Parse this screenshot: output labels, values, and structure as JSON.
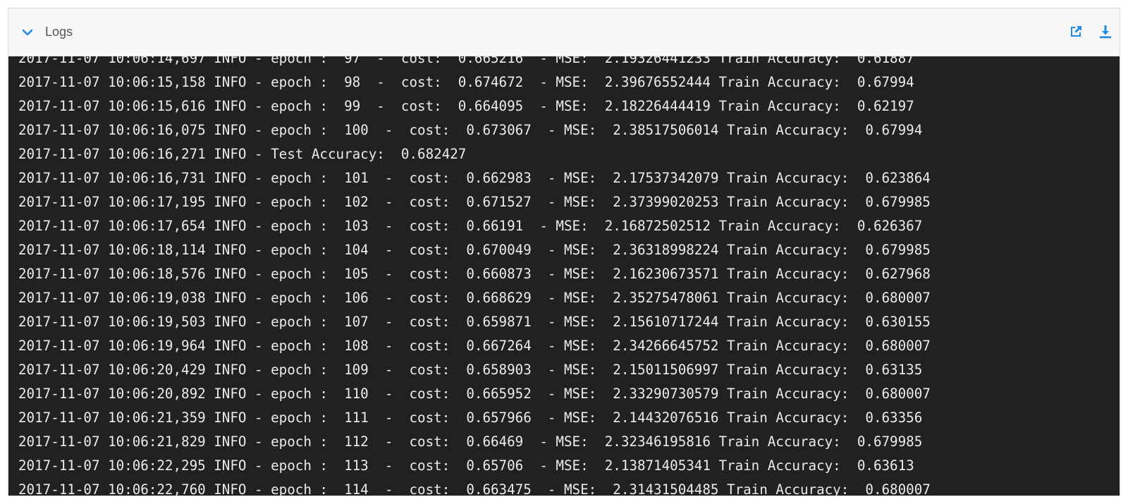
{
  "panel": {
    "title": "Logs",
    "toggle_icon": "chevron-down-icon",
    "actions": [
      {
        "name": "open-external",
        "icon": "external-link-icon"
      },
      {
        "name": "download",
        "icon": "download-icon"
      }
    ],
    "accent_color": "#1e88e5",
    "console_background": "#212121",
    "console_text_color": "#ececec"
  },
  "logs": {
    "lines": [
      "2017-11-07 10:06:14,697 INFO - epoch :  97  -  cost:  0.665216  - MSE:  2.19326441233 Train Accuracy:  0.61887",
      "2017-11-07 10:06:15,158 INFO - epoch :  98  -  cost:  0.674672  - MSE:  2.39676552444 Train Accuracy:  0.67994",
      "2017-11-07 10:06:15,616 INFO - epoch :  99  -  cost:  0.664095  - MSE:  2.18226444419 Train Accuracy:  0.62197",
      "2017-11-07 10:06:16,075 INFO - epoch :  100  -  cost:  0.673067  - MSE:  2.38517506014 Train Accuracy:  0.67994",
      "2017-11-07 10:06:16,271 INFO - Test Accuracy:  0.682427",
      "2017-11-07 10:06:16,731 INFO - epoch :  101  -  cost:  0.662983  - MSE:  2.17537342079 Train Accuracy:  0.623864",
      "2017-11-07 10:06:17,195 INFO - epoch :  102  -  cost:  0.671527  - MSE:  2.37399020253 Train Accuracy:  0.679985",
      "2017-11-07 10:06:17,654 INFO - epoch :  103  -  cost:  0.66191  - MSE:  2.16872502512 Train Accuracy:  0.626367",
      "2017-11-07 10:06:18,114 INFO - epoch :  104  -  cost:  0.670049  - MSE:  2.36318998224 Train Accuracy:  0.679985",
      "2017-11-07 10:06:18,576 INFO - epoch :  105  -  cost:  0.660873  - MSE:  2.16230673571 Train Accuracy:  0.627968",
      "2017-11-07 10:06:19,038 INFO - epoch :  106  -  cost:  0.668629  - MSE:  2.35275478061 Train Accuracy:  0.680007",
      "2017-11-07 10:06:19,503 INFO - epoch :  107  -  cost:  0.659871  - MSE:  2.15610717244 Train Accuracy:  0.630155",
      "2017-11-07 10:06:19,964 INFO - epoch :  108  -  cost:  0.667264  - MSE:  2.34266645752 Train Accuracy:  0.680007",
      "2017-11-07 10:06:20,429 INFO - epoch :  109  -  cost:  0.658903  - MSE:  2.15011506997 Train Accuracy:  0.63135",
      "2017-11-07 10:06:20,892 INFO - epoch :  110  -  cost:  0.665952  - MSE:  2.33290730579 Train Accuracy:  0.680007",
      "2017-11-07 10:06:21,359 INFO - epoch :  111  -  cost:  0.657966  - MSE:  2.14432076516 Train Accuracy:  0.63356",
      "2017-11-07 10:06:21,829 INFO - epoch :  112  -  cost:  0.66469  - MSE:  2.32346195816 Train Accuracy:  0.679985",
      "2017-11-07 10:06:22,295 INFO - epoch :  113  -  cost:  0.65706  - MSE:  2.13871405341 Train Accuracy:  0.63613",
      "2017-11-07 10:06:22,760 INFO - epoch :  114  -  cost:  0.663475  - MSE:  2.31431504485 Train Accuracy:  0.680007"
    ]
  }
}
